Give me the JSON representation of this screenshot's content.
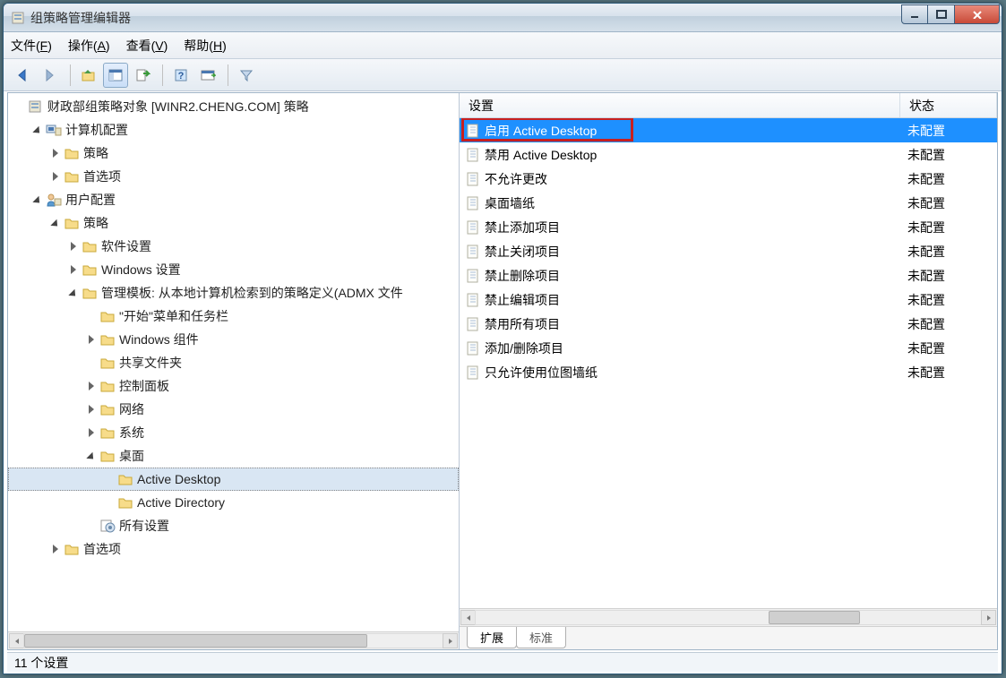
{
  "window": {
    "title": "组策略管理编辑器"
  },
  "menubar": [
    {
      "label": "文件",
      "hotkey": "F"
    },
    {
      "label": "操作",
      "hotkey": "A"
    },
    {
      "label": "查看",
      "hotkey": "V"
    },
    {
      "label": "帮助",
      "hotkey": "H"
    }
  ],
  "root": {
    "label": "财政部组策略对象 [WINR2.CHENG.COM] 策略",
    "children": [
      {
        "label": "计算机配置",
        "icon": "computer",
        "expanded": true,
        "children": [
          {
            "label": "策略",
            "icon": "folder",
            "expanded": false,
            "has": true
          },
          {
            "label": "首选项",
            "icon": "folder",
            "expanded": false,
            "has": true
          }
        ]
      },
      {
        "label": "用户配置",
        "icon": "user",
        "expanded": true,
        "children": [
          {
            "label": "策略",
            "icon": "folder",
            "expanded": true,
            "children": [
              {
                "label": "软件设置",
                "icon": "folder",
                "expanded": false,
                "has": true
              },
              {
                "label": "Windows 设置",
                "icon": "folder",
                "expanded": false,
                "has": true
              },
              {
                "label": "管理模板: 从本地计算机检索到的策略定义(ADMX 文件",
                "icon": "folder",
                "expanded": true,
                "children": [
                  {
                    "label": "\"开始\"菜单和任务栏",
                    "icon": "folder"
                  },
                  {
                    "label": "Windows 组件",
                    "icon": "folder",
                    "expanded": false,
                    "has": true
                  },
                  {
                    "label": "共享文件夹",
                    "icon": "folder"
                  },
                  {
                    "label": "控制面板",
                    "icon": "folder",
                    "expanded": false,
                    "has": true
                  },
                  {
                    "label": "网络",
                    "icon": "folder",
                    "expanded": false,
                    "has": true
                  },
                  {
                    "label": "系统",
                    "icon": "folder",
                    "expanded": false,
                    "has": true
                  },
                  {
                    "label": "桌面",
                    "icon": "folder",
                    "expanded": true,
                    "children": [
                      {
                        "label": "Active Desktop",
                        "icon": "folder",
                        "selected": true
                      },
                      {
                        "label": "Active Directory",
                        "icon": "folder"
                      }
                    ]
                  },
                  {
                    "label": "所有设置",
                    "icon": "settings"
                  }
                ]
              }
            ]
          },
          {
            "label": "首选项",
            "icon": "folder",
            "expanded": false,
            "has": true
          }
        ]
      }
    ]
  },
  "columns": {
    "name": "设置",
    "state": "状态"
  },
  "settings": [
    {
      "label": "启用 Active Desktop",
      "state": "未配置",
      "selected": true,
      "highlight": true
    },
    {
      "label": "禁用 Active Desktop",
      "state": "未配置"
    },
    {
      "label": "不允许更改",
      "state": "未配置"
    },
    {
      "label": "桌面墙纸",
      "state": "未配置"
    },
    {
      "label": "禁止添加项目",
      "state": "未配置"
    },
    {
      "label": "禁止关闭项目",
      "state": "未配置"
    },
    {
      "label": "禁止删除项目",
      "state": "未配置"
    },
    {
      "label": "禁止编辑项目",
      "state": "未配置"
    },
    {
      "label": "禁用所有项目",
      "state": "未配置"
    },
    {
      "label": "添加/删除项目",
      "state": "未配置"
    },
    {
      "label": "只允许使用位图墙纸",
      "state": "未配置"
    }
  ],
  "tabs": [
    {
      "label": "扩展",
      "active": true
    },
    {
      "label": "标准",
      "active": false
    }
  ],
  "status": "11 个设置"
}
